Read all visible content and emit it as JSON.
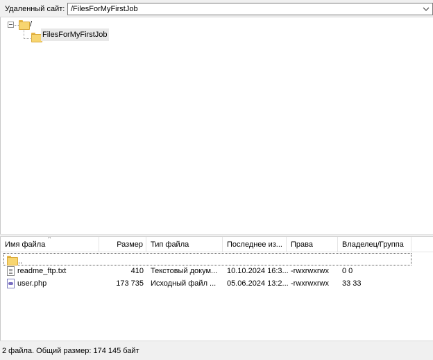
{
  "pathbar": {
    "label": "Удаленный сайт:",
    "value": "/FilesForMyFirstJob"
  },
  "tree": {
    "root": {
      "label": "/",
      "expanded": true
    },
    "children": [
      {
        "label": "FilesForMyFirstJob",
        "selected": true
      }
    ]
  },
  "list": {
    "columns": [
      {
        "label": "Имя файла"
      },
      {
        "label": "Размер"
      },
      {
        "label": "Тип файла"
      },
      {
        "label": "Последнее из..."
      },
      {
        "label": "Права"
      },
      {
        "label": "Владелец/Группа"
      }
    ],
    "parent_row": {
      "name": ".."
    },
    "rows": [
      {
        "name": "readme_ftp.txt",
        "size": "410",
        "type": "Текстовый докум...",
        "modified": "10.10.2024 16:3...",
        "perms": "-rwxrwxrwx",
        "owner": "0 0",
        "icon": "text-file-icon"
      },
      {
        "name": "user.php",
        "size": "173 735",
        "type": "Исходный файл ...",
        "modified": "05.06.2024 13:2...",
        "perms": "-rwxrwxrwx",
        "owner": "33 33",
        "icon": "php-file-icon"
      }
    ]
  },
  "status": {
    "text": "2 файла. Общий размер: 174 145 байт"
  },
  "colors": {
    "folder": "#f7d570",
    "chrome": "#f0f0f0",
    "selection": "#e8e8e8"
  }
}
